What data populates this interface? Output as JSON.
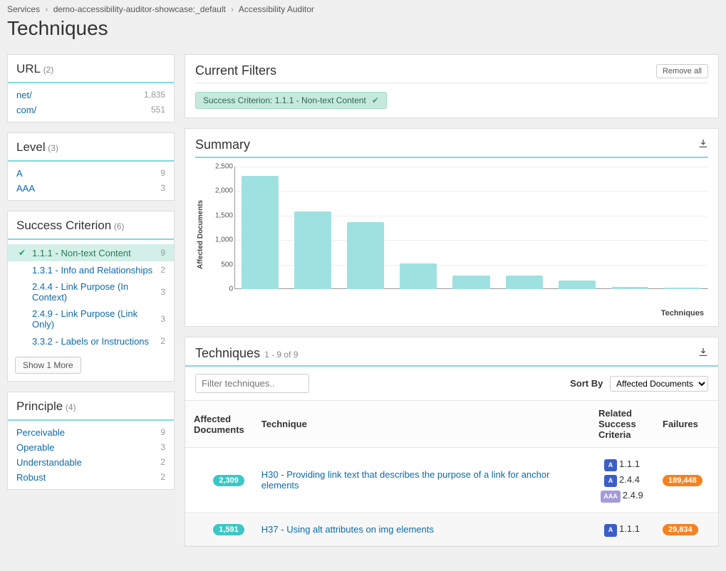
{
  "breadcrumbs": {
    "items": [
      "Services",
      "demo-accessibility-auditor-showcase:_default",
      "Accessibility Auditor"
    ]
  },
  "page_title": "Techniques",
  "sidebar": {
    "url": {
      "title": "URL",
      "count": "(2)",
      "items": [
        {
          "label": "net/",
          "count": "1,835"
        },
        {
          "label": "com/",
          "count": "551"
        }
      ]
    },
    "level": {
      "title": "Level",
      "count": "(3)",
      "items": [
        {
          "label": "A",
          "count": "9"
        },
        {
          "label": "AAA",
          "count": "3"
        }
      ]
    },
    "success": {
      "title": "Success Criterion",
      "count": "(6)",
      "items": [
        {
          "label": "1.1.1 - Non-text Content",
          "count": "9",
          "selected": true
        },
        {
          "label": "1.3.1 - Info and Relationships",
          "count": "2"
        },
        {
          "label": "2.4.4 - Link Purpose (In Context)",
          "count": "3"
        },
        {
          "label": "2.4.9 - Link Purpose (Link Only)",
          "count": "3"
        },
        {
          "label": "3.3.2 - Labels or Instructions",
          "count": "2"
        }
      ],
      "show_more": "Show 1 More"
    },
    "principle": {
      "title": "Principle",
      "count": "(4)",
      "items": [
        {
          "label": "Perceivable",
          "count": "9"
        },
        {
          "label": "Operable",
          "count": "3"
        },
        {
          "label": "Understandable",
          "count": "2"
        },
        {
          "label": "Robust",
          "count": "2"
        }
      ]
    }
  },
  "current_filters": {
    "title": "Current Filters",
    "remove_all": "Remove all",
    "tag": "Success Criterion: 1.1.1 - Non-text Content"
  },
  "summary": {
    "title": "Summary",
    "ylabel": "Affected Documents",
    "xlabel": "Techniques"
  },
  "chart_data": {
    "type": "bar",
    "ylabel": "Affected Documents",
    "xlabel": "Techniques",
    "ylim": [
      0,
      2500
    ],
    "yticks": [
      "0",
      "500",
      "1,000",
      "1,500",
      "2,000",
      "2,500"
    ],
    "categories": [
      "",
      "",
      "",
      "",
      "",
      "",
      "",
      "",
      ""
    ],
    "values": [
      2309,
      1591,
      1360,
      520,
      280,
      270,
      180,
      40,
      30
    ]
  },
  "techniques": {
    "title": "Techniques",
    "range": "1 - 9 of 9",
    "filter_placeholder": "Filter techniques..",
    "sort_by_label": "Sort By",
    "sort_by_value": "Affected Documents",
    "headers": {
      "affected": "Affected Documents",
      "technique": "Technique",
      "related": "Related Success Criteria",
      "failures": "Failures"
    },
    "rows": [
      {
        "affected": "2,309",
        "technique": "H30 - Providing link text that describes the purpose of a link for anchor elements",
        "related": [
          {
            "level": "A",
            "sc": "1.1.1"
          },
          {
            "level": "A",
            "sc": "2.4.4"
          },
          {
            "level": "AAA",
            "sc": "2.4.9"
          }
        ],
        "failures": "189,448"
      },
      {
        "affected": "1,591",
        "technique": "H37 - Using alt attributes on img elements",
        "related": [
          {
            "level": "A",
            "sc": "1.1.1"
          }
        ],
        "failures": "29,834"
      }
    ]
  }
}
